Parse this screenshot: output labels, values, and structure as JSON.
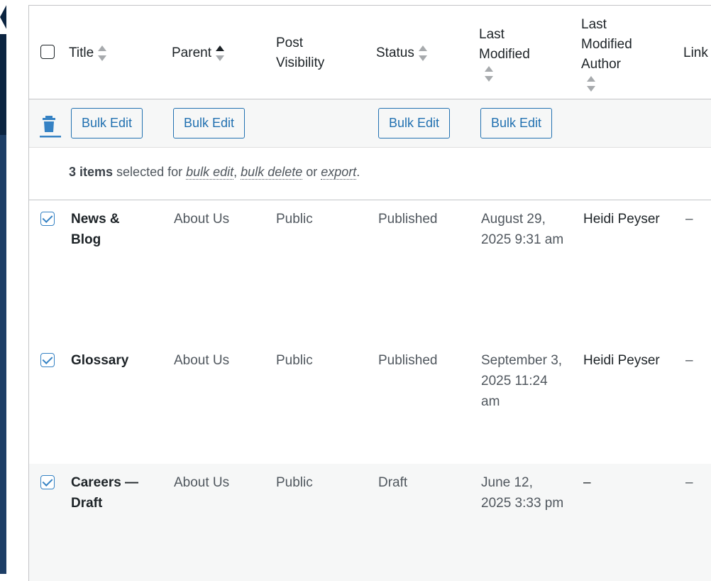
{
  "header": {
    "title": "Title",
    "parent": "Parent",
    "visibility": "Post Visibility",
    "status": "Status",
    "last_modified": "Last Modified",
    "last_modified_author": "Last Modified Author",
    "link": "Link"
  },
  "bulk": {
    "bulk_edit_label": "Bulk Edit",
    "trash_icon": "trash-icon"
  },
  "selection": {
    "count": "3 items",
    "selected_for": " selected for ",
    "bulk_edit": "bulk edit",
    "comma": ", ",
    "bulk_delete": "bulk delete",
    "or": " or ",
    "export": "export",
    "period": "."
  },
  "rows": [
    {
      "title": "News & Blog",
      "parent": "About Us",
      "visibility": "Public",
      "status": "Published",
      "modified": "August 29, 2025 9:31 am",
      "author": "Heidi Peyser",
      "link": "–",
      "checked": true
    },
    {
      "title": "Glossary",
      "parent": "About Us",
      "visibility": "Public",
      "status": "Published",
      "modified": "September 3, 2025 11:24 am",
      "author": "Heidi Peyser",
      "link": "–",
      "checked": true
    },
    {
      "title": "Careers — Draft",
      "parent": "About Us",
      "visibility": "Public",
      "status": "Draft",
      "modified": "June 12, 2025 3:33 pm",
      "author": "–",
      "link": "–",
      "checked": true
    }
  ],
  "colors": {
    "accent": "#2271b1",
    "checkbox": "#3582c4",
    "admin_sidebar": "#1d3e66"
  }
}
